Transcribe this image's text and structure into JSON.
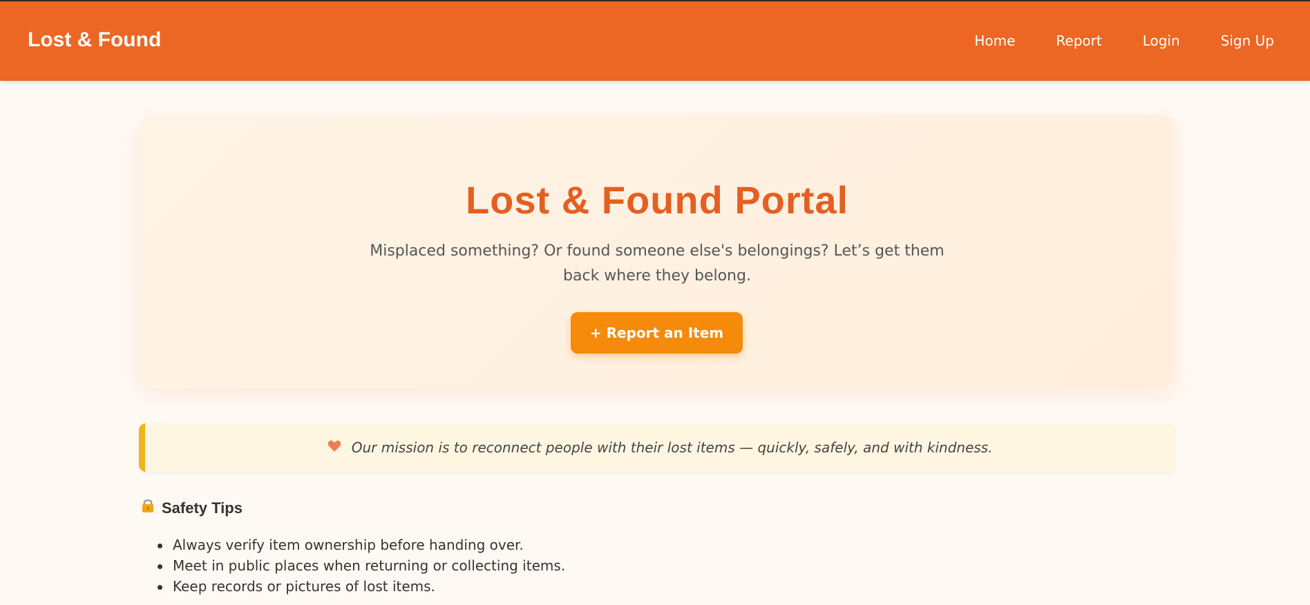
{
  "navbar": {
    "brand": "Lost & Found",
    "links": [
      "Home",
      "Report",
      "Login",
      "Sign Up"
    ]
  },
  "hero": {
    "title": "Lost & Found Portal",
    "subtitle": "Misplaced something? Or found someone else's belongings? Let’s get them back where they belong.",
    "button_label": "+ Report an Item"
  },
  "mission": {
    "icon": "heart-icon",
    "text": "Our mission is to reconnect people with their lost items — quickly, safely, and with kindness."
  },
  "safety": {
    "icon": "lock-icon",
    "title": "Safety Tips",
    "tips": [
      "Always verify item ownership before handing over.",
      "Meet in public places when returning or collecting items.",
      "Keep records or pictures of lost items."
    ]
  },
  "colors": {
    "navbar": "#ec6624",
    "accent": "#e45f21",
    "button": "#f58a0b",
    "mission_border": "#f2b21b"
  }
}
